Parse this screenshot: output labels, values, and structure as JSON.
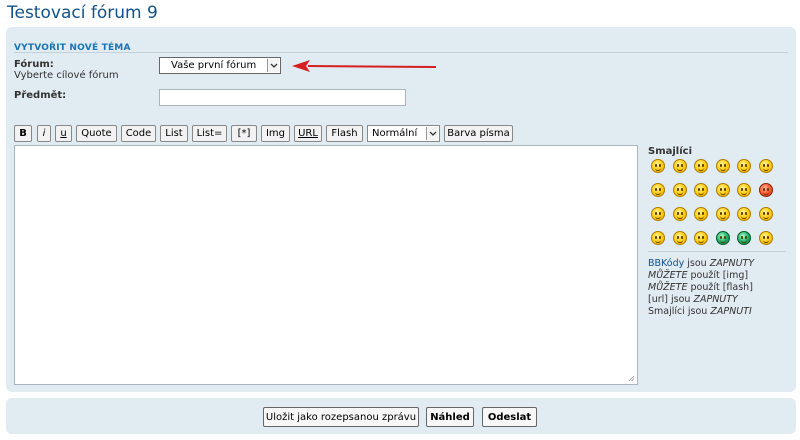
{
  "page": {
    "title": "Testovací fórum 9"
  },
  "panel": {
    "header": "VYTVOŘIT NOVÉ TÉMA"
  },
  "form": {
    "forum_label": "Fórum:",
    "forum_hint": "Vyberte cílové fórum",
    "forum_selected": "Vaše první fórum",
    "subject_label": "Předmět:",
    "subject_value": ""
  },
  "toolbar": {
    "buttons": [
      "B",
      "i",
      "u",
      "Quote",
      "Code",
      "List",
      "List=",
      "[*]",
      "Img",
      "URL",
      "Flash"
    ],
    "font_size_selected": "Normální",
    "font_color_label": "Barva písma"
  },
  "smilies": {
    "title": "Smajlíci",
    "icons": [
      "laughing-smiley-icon",
      "frown-smiley-icon",
      "smile-smiley-icon",
      "neutral-smiley-icon",
      "surprised-smiley-icon",
      "shocked-smiley-icon",
      "confused-smiley-icon",
      "cool-smiley-icon",
      "grin-smiley-icon",
      "sad-smiley-icon",
      "wink-smiley-icon",
      "mad-smiley-icon",
      "geek-smiley-icon",
      "evil-smiley-icon",
      "twisted-smiley-icon",
      "rolleyes-smiley-icon",
      "exclaim-smiley-icon",
      "question-smiley-icon",
      "idea-smiley-icon",
      "arrow-smiley-icon",
      "razz-smiley-icon",
      "alien-smiley-icon",
      "ugeek-smiley-icon",
      "nerd-smiley-icon"
    ]
  },
  "info": {
    "line1_link": "BBKódy",
    "line1_rest": " jsou ",
    "line1_state": "ZAPNUTY",
    "line2_state": "MŮŽETE",
    "line2_rest": " použít [img]",
    "line3_state": "MŮŽETE",
    "line3_rest": " použít [flash]",
    "line4_rest": "[url] jsou ",
    "line4_state": "ZAPNUTY",
    "line5_rest": "Smajlíci jsou ",
    "line5_state": "ZAPNUTI"
  },
  "footer": {
    "save_draft": "Uložit jako rozepsanou zprávu",
    "preview": "Náhled",
    "submit": "Odeslat"
  },
  "colors": {
    "accent": "#105289",
    "panel_bg": "#e1ebf2",
    "arrow": "#d42020"
  }
}
